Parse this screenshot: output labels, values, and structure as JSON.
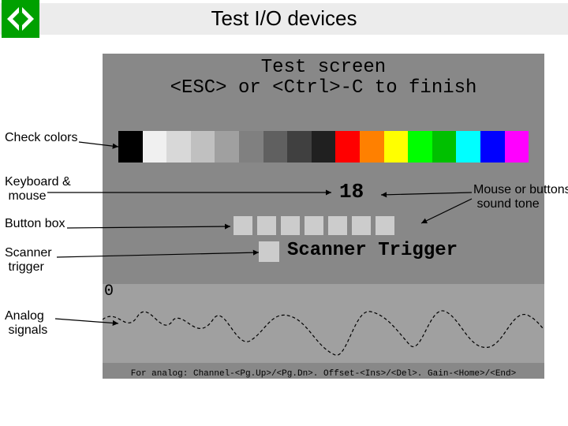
{
  "title": "Test I/O devices",
  "test_screen": {
    "line1": "Test screen",
    "line2": "<ESC> or <Ctrl>-C to finish",
    "keyboard_value": "18",
    "scanner_label": "Scanner Trigger",
    "analog_zero": "0",
    "footer": "For analog:  Channel-<Pg.Up>/<Pg.Dn>.  Offset-<Ins>/<Del>.  Gain-<Home>/<End>"
  },
  "color_swatches": [
    "#000000",
    "#f0f0f0",
    "#d8d8d8",
    "#c0c0c0",
    "#a0a0a0",
    "#808080",
    "#606060",
    "#404040",
    "#202020",
    "#ff0000",
    "#ff8000",
    "#ffff00",
    "#00ff00",
    "#00c000",
    "#00ffff",
    "#0000ff",
    "#ff00ff"
  ],
  "labels": {
    "check_colors": "Check colors",
    "keyboard_mouse": "Keyboard &\n mouse",
    "button_box": "Button box",
    "scanner_trigger": "Scanner\n trigger",
    "analog_signals": "Analog\n signals",
    "mouse_tone": "Mouse or buttons\n sound tone"
  }
}
